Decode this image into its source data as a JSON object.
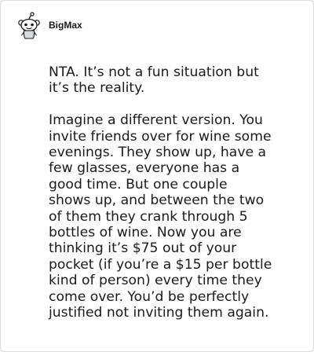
{
  "post": {
    "username": "BigMax",
    "avatar_icon": "reddit-snoo-avatar-icon",
    "paragraphs": [
      "NTA. It’s not a fun situation but\nit’s the reality.",
      "Imagine a different version. You\ninvite friends over for wine some\nevenings. They show up, have a\nfew glasses, everyone has a\ngood time. But one couple\nshows up, and between the two\nof them they crank through 5\nbottles of wine. Now you are\nthinking it’s $75 out of your\npocket (if you’re a $15 per bottle\nkind of person) every time they\ncome over. You’d be perfectly\njustified not inviting them again."
    ]
  },
  "colors": {
    "text": "#1a1a1b",
    "card_border": "#dcdcdc",
    "background": "#ffffff"
  }
}
